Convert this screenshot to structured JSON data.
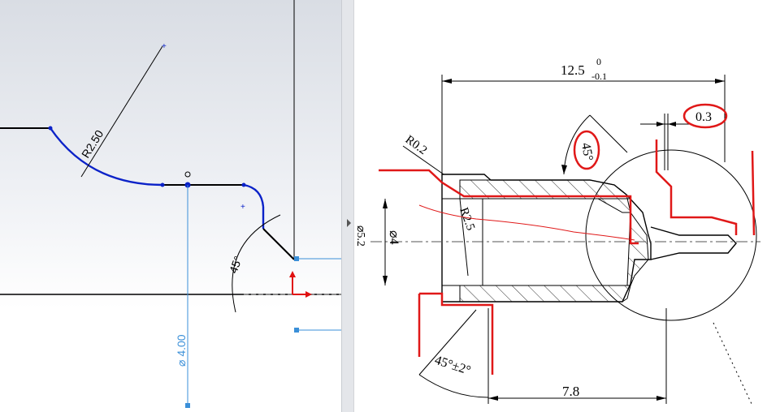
{
  "sketch": {
    "radius_label": "R2.50",
    "angle_label": "45°",
    "diameter_label": "⌀ 4.00",
    "colors": {
      "background_top": "#d9dde4",
      "sketch_line": "#000000",
      "arc_selected": "#0b22c8",
      "dimension_blue": "#3a8fd8",
      "origin_red": "#e01010"
    }
  },
  "splitter": {
    "arrow_icon": "triangle-right-icon"
  },
  "drawing": {
    "overall_length": "12.5",
    "overall_length_upper_tol": "0",
    "overall_length_lower_tol": "-0.1",
    "gap_dim": "0.3",
    "chamfer_angle": "45°",
    "radius_small": "R0.2",
    "radius_large": "R2.5",
    "inner_diameter": "⌀4",
    "outer_diameter": "⌀5.2",
    "lower_angle": "45°±2°",
    "bottom_length": "7.8",
    "colors": {
      "markup_red": "#e01818",
      "line": "#000000",
      "hatch": "#333333"
    }
  }
}
